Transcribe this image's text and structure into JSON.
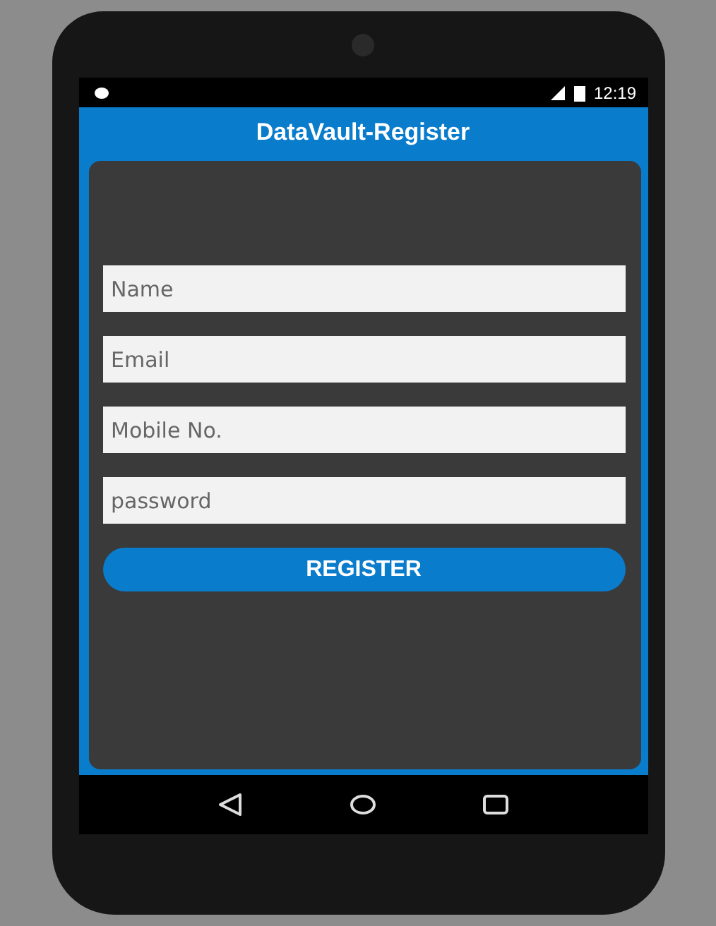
{
  "status_bar": {
    "time": "12:19"
  },
  "app_bar": {
    "title": "DataVault-Register"
  },
  "fields": [
    {
      "placeholder": "Name"
    },
    {
      "placeholder": "Email"
    },
    {
      "placeholder": "Mobile No."
    },
    {
      "placeholder": "password"
    }
  ],
  "button": {
    "label": "REGISTER"
  }
}
